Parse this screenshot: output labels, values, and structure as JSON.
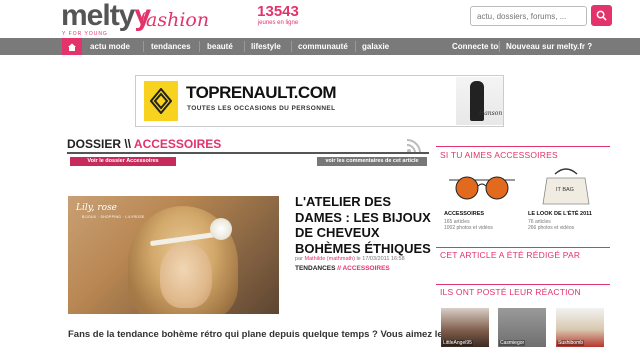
{
  "header": {
    "logo_main": "melty",
    "logo_y": "y",
    "logo_fashion": "fashion",
    "logo_tagline": "Y FOR YOUNG",
    "online_count": "13543",
    "online_label": "jeunes en ligne",
    "search_placeholder": "actu, dossiers, forums, ..."
  },
  "nav": {
    "items": [
      "actu mode",
      "tendances",
      "beauté",
      "lifestyle",
      "communauté",
      "galaxie"
    ],
    "right": [
      "Connecte toi",
      "Nouveau sur melty.fr ? Inscription"
    ]
  },
  "banner": {
    "brand": "TOPRENAULT.COM",
    "subtitle": "TOUTES LES OCCASIONS DU PERSONNEL",
    "logo_label": "RENAULT",
    "signature": "Hanson"
  },
  "dossier": {
    "prefix": "DOSSIER \\\\ ",
    "name": "ACCESSOIRES",
    "btn_dossier": "Voir le dossier Accessoires",
    "btn_comments": "voir les commentaires de cet article"
  },
  "article": {
    "image_caption": "Lily, rose",
    "image_caption_sub": "BIJOUX · SHOPPING · LILYROSE",
    "title": "L'ATELIER DES DAMES : LES BIJOUX DE CHEVEUX BOHÈMES ÉTHIQUES",
    "meta_prefix": "par ",
    "author": "Mathilde (mathmath)",
    "meta_date": " le 17/03/2011 16:58",
    "tag1": "TENDANCES",
    "tag_sep": " // ",
    "tag2": "ACCESSOIRES",
    "intro": "Fans de la tendance bohème rétro qui plane depuis quelque temps ? Vous aimez les"
  },
  "sidebar": {
    "title1": "SI TU AIMES ACCESSOIRES",
    "cards": [
      {
        "name": "ACCESSOIRES",
        "stat1": "165 articles",
        "stat2": "1002 photos et vidéos"
      },
      {
        "name": "LE LOOK DE L'ÉTÉ 2011",
        "stat1": "76 articles",
        "stat2": "266 photos et vidéos",
        "bag_text": "IT BAG"
      }
    ],
    "title2": "CET ARTICLE A ÉTÉ RÉDIGÉ PAR",
    "title3": "ILS ONT POSTÉ LEUR RÉACTION",
    "reactors": [
      "LittleAngel95",
      "Casmiegor",
      "Sushibomb"
    ]
  },
  "colors": {
    "accent": "#e2336b",
    "nav_bg": "#7a7a7a"
  }
}
